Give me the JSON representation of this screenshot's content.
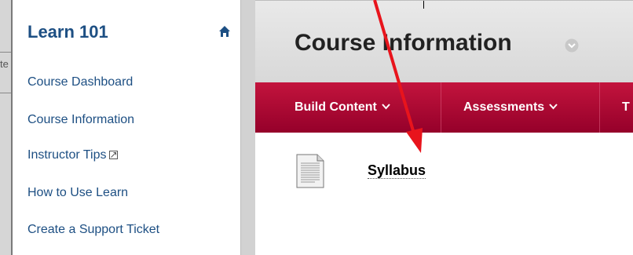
{
  "left_edge": {
    "cut_text": "te"
  },
  "sidebar": {
    "course_title": "Learn 101",
    "home_icon": "home-icon",
    "items": [
      {
        "label": "Course Dashboard"
      },
      {
        "label": "Course Information"
      },
      {
        "label": "Instructor Tips",
        "icon": "external-link-icon"
      },
      {
        "label": "How to Use Learn"
      },
      {
        "label": "Create a Support Ticket"
      }
    ]
  },
  "main": {
    "title": "Course Information",
    "title_icon": "chevron-down-circle-icon",
    "menu": [
      {
        "label": "Build Content"
      },
      {
        "label": "Assessments"
      },
      {
        "label": "T"
      }
    ],
    "content_items": [
      {
        "title": "Syllabus",
        "icon": "document-icon"
      }
    ]
  },
  "colors": {
    "link_blue": "#1d4f83",
    "menu_red": "#c3143d",
    "menu_red_dark": "#95002a",
    "annotation_red": "#e8141c"
  }
}
